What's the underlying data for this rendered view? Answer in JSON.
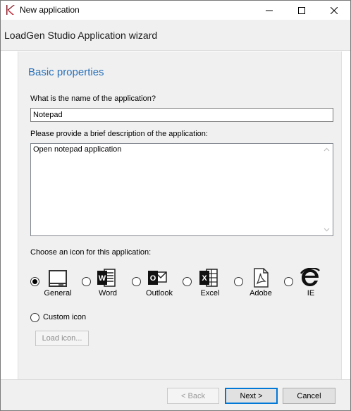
{
  "window": {
    "title": "New application",
    "controls": {
      "minimize_icon": "minimize-icon",
      "maximize_icon": "maximize-icon",
      "close_icon": "close-icon"
    }
  },
  "header": {
    "title": "LoadGen Studio Application wizard"
  },
  "section": {
    "title": "Basic properties"
  },
  "form": {
    "name_label": "What is the name of the application?",
    "name_value": "Notepad",
    "description_label": "Please provide a brief description of the application:",
    "description_value": "Open notepad application",
    "icon_label": "Choose an icon for this application:"
  },
  "icons": [
    {
      "label": "General",
      "icon": "monitor-icon",
      "selected": true
    },
    {
      "label": "Word",
      "icon": "word-icon",
      "selected": false
    },
    {
      "label": "Outlook",
      "icon": "outlook-icon",
      "selected": false
    },
    {
      "label": "Excel",
      "icon": "excel-icon",
      "selected": false
    },
    {
      "label": "Adobe",
      "icon": "adobe-icon",
      "selected": false
    },
    {
      "label": "IE",
      "icon": "ie-icon",
      "selected": false
    }
  ],
  "custom_icon": {
    "label": "Custom icon",
    "selected": false
  },
  "load_icon_button": "Load icon...",
  "footer": {
    "back_label": "< Back",
    "next_label": "Next >",
    "cancel_label": "Cancel"
  },
  "colors": {
    "accent": "#2a71b8",
    "focus": "#0078d7"
  }
}
